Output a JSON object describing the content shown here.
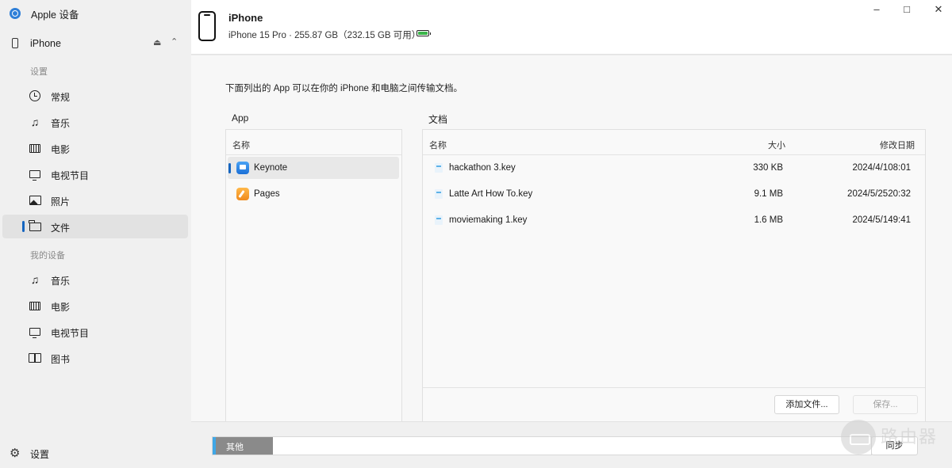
{
  "app": {
    "title": "Apple 设备"
  },
  "window": {
    "minimize": "–",
    "maximize": "□",
    "close": "✕"
  },
  "sidebar": {
    "device": {
      "name": "iPhone",
      "eject": "⏏",
      "collapse": "⌃"
    },
    "section_settings": "设置",
    "settings_items": [
      {
        "label": "常规",
        "icon": "clock-icon"
      },
      {
        "label": "音乐",
        "icon": "music-note-icon"
      },
      {
        "label": "电影",
        "icon": "film-icon"
      },
      {
        "label": "电视节目",
        "icon": "tv-icon"
      },
      {
        "label": "照片",
        "icon": "photo-icon"
      },
      {
        "label": "文件",
        "icon": "folder-icon",
        "active": true
      }
    ],
    "section_mydevice": "我的设备",
    "mydevice_items": [
      {
        "label": "音乐",
        "icon": "music-note-icon"
      },
      {
        "label": "电影",
        "icon": "film-icon"
      },
      {
        "label": "电视节目",
        "icon": "tv-icon"
      },
      {
        "label": "图书",
        "icon": "book-icon"
      }
    ],
    "settings": {
      "label": "设置",
      "icon": "gear-icon"
    }
  },
  "header": {
    "device_name": "iPhone",
    "device_info": "iPhone 15 Pro · 255.87 GB（232.15 GB 可用）",
    "battery_color": "#3bb54a"
  },
  "main": {
    "intro": "下面列出的 App 可以在你的 iPhone 和电脑之间传输文档。",
    "app_panel_label": "App",
    "doc_panel_label": "文档",
    "app_col_name": "名称",
    "apps": [
      {
        "name": "Keynote",
        "selected": true
      },
      {
        "name": "Pages",
        "selected": false
      }
    ],
    "doc_columns": {
      "name": "名称",
      "size": "大小",
      "date": "修改日期"
    },
    "documents": [
      {
        "name": "hackathon 3.key",
        "size": "330 KB",
        "date": "2024/4/108:01"
      },
      {
        "name": "Latte Art How To.key",
        "size": "9.1 MB",
        "date": "2024/5/2520:32"
      },
      {
        "name": "moviemaking 1.key",
        "size": "1.6 MB",
        "date": "2024/5/149:41"
      }
    ],
    "add_file_button": "添加文件...",
    "save_button": "保存..."
  },
  "footer": {
    "storage_label": "其他",
    "sync_button": "同步"
  },
  "watermark": {
    "text": "路由器"
  },
  "colors": {
    "accent": "#1565c0",
    "storage_blue": "#3fa7e6",
    "storage_grey": "#8a8a8a"
  }
}
